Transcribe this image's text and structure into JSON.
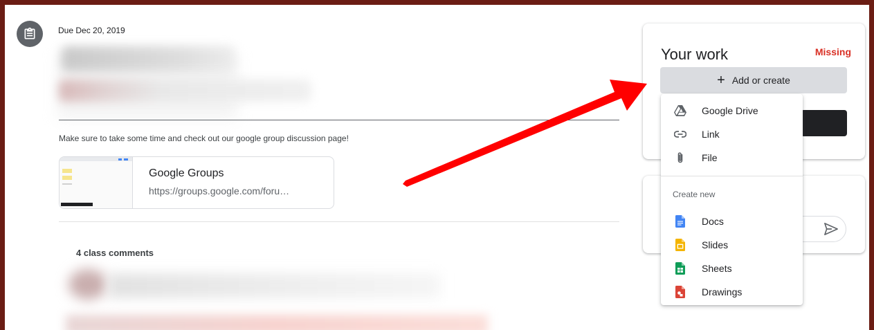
{
  "assignment": {
    "due": "Due Dec 20, 2019",
    "description": "Make sure to take some time and check out our google group discussion page!",
    "attachment": {
      "title": "Google Groups",
      "url": "https://groups.google.com/foru…"
    },
    "comments_heading": "4 class comments"
  },
  "your_work": {
    "title": "Your work",
    "status": "Missing",
    "add_button": "Add or create"
  },
  "menu": {
    "items": [
      {
        "label": "Google Drive",
        "icon": "google-drive-icon"
      },
      {
        "label": "Link",
        "icon": "link-icon"
      },
      {
        "label": "File",
        "icon": "paperclip-icon"
      }
    ],
    "create_new_label": "Create new",
    "create_items": [
      {
        "label": "Docs",
        "icon": "docs-icon",
        "color": "#4285f4"
      },
      {
        "label": "Slides",
        "icon": "slides-icon",
        "color": "#f4b400"
      },
      {
        "label": "Sheets",
        "icon": "sheets-icon",
        "color": "#0f9d58"
      },
      {
        "label": "Drawings",
        "icon": "drawings-icon",
        "color": "#db4437"
      }
    ]
  },
  "colors": {
    "missing": "#d93025",
    "annotation_arrow": "#ff0000",
    "frame": "#6b1d14"
  }
}
